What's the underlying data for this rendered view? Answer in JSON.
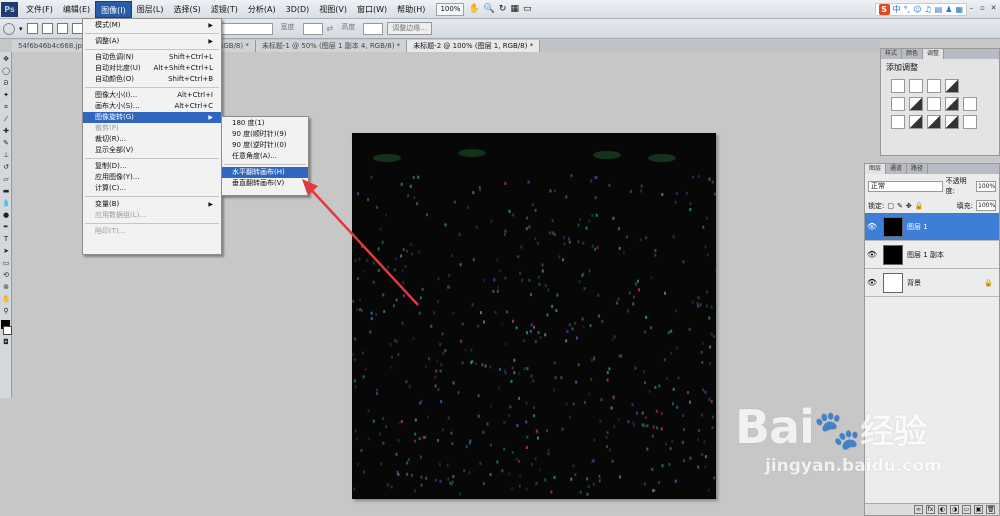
{
  "menubar": {
    "logo": "Ps",
    "items": [
      "文件(F)",
      "编辑(E)",
      "图像(I)",
      "图层(L)",
      "选择(S)",
      "滤镜(T)",
      "分析(A)",
      "3D(D)",
      "视图(V)",
      "窗口(W)",
      "帮助(H)"
    ],
    "active_index": 2,
    "zoom": "100%"
  },
  "optbar": {
    "field1": "宽度",
    "field2": "高度",
    "refine_edge": "调整边缘..."
  },
  "tabs": [
    {
      "label": "54f6b46b4c668.jpg",
      "active": false
    },
    {
      "label": "9824111440.jpg @ 200% (图层 0, RGB/8) *",
      "active": false
    },
    {
      "label": "未标题-1 @ 50% (图层 1 副本 4, RGB/8) *",
      "active": false
    },
    {
      "label": "未标题-2 @ 100% (图层 1, RGB/8) *",
      "active": true
    }
  ],
  "image_menu": {
    "items": [
      {
        "label": "模式(M)",
        "shortcut": "",
        "submenu": true,
        "disabled": false
      },
      {
        "sep": true
      },
      {
        "label": "调整(A)",
        "shortcut": "",
        "submenu": true,
        "disabled": false
      },
      {
        "sep": true
      },
      {
        "label": "自动色调(N)",
        "shortcut": "Shift+Ctrl+L",
        "submenu": false,
        "disabled": false
      },
      {
        "label": "自动对比度(U)",
        "shortcut": "Alt+Shift+Ctrl+L",
        "submenu": false,
        "disabled": false
      },
      {
        "label": "自动颜色(O)",
        "shortcut": "Shift+Ctrl+B",
        "submenu": false,
        "disabled": false
      },
      {
        "sep": true
      },
      {
        "label": "图像大小(I)...",
        "shortcut": "Alt+Ctrl+I",
        "submenu": false,
        "disabled": false
      },
      {
        "label": "画布大小(S)...",
        "shortcut": "Alt+Ctrl+C",
        "submenu": false,
        "disabled": false
      },
      {
        "label": "图像旋转(G)",
        "shortcut": "",
        "submenu": true,
        "disabled": false,
        "selected": true
      },
      {
        "label": "裁剪(P)",
        "shortcut": "",
        "submenu": false,
        "disabled": true
      },
      {
        "label": "裁切(R)...",
        "shortcut": "",
        "submenu": false,
        "disabled": false
      },
      {
        "label": "显示全部(V)",
        "shortcut": "",
        "submenu": false,
        "disabled": false
      },
      {
        "sep": true
      },
      {
        "label": "复制(D)...",
        "shortcut": "",
        "submenu": false,
        "disabled": false
      },
      {
        "label": "应用图像(Y)...",
        "shortcut": "",
        "submenu": false,
        "disabled": false
      },
      {
        "label": "计算(C)...",
        "shortcut": "",
        "submenu": false,
        "disabled": false
      },
      {
        "sep": true
      },
      {
        "label": "变量(B)",
        "shortcut": "",
        "submenu": true,
        "disabled": false
      },
      {
        "label": "应用数据组(L)...",
        "shortcut": "",
        "submenu": false,
        "disabled": true
      },
      {
        "sep": true
      },
      {
        "label": "陷印(T)...",
        "shortcut": "",
        "submenu": false,
        "disabled": true
      }
    ]
  },
  "rotate_submenu": {
    "items": [
      {
        "label": "180 度(1)",
        "selected": false
      },
      {
        "label": "90 度(顺时针)(9)",
        "selected": false
      },
      {
        "label": "90 度(逆时针)(0)",
        "selected": false
      },
      {
        "label": "任意角度(A)...",
        "selected": false
      },
      {
        "sep": true
      },
      {
        "label": "水平翻转画布(H)",
        "selected": true
      },
      {
        "label": "垂直翻转画布(V)",
        "selected": false
      }
    ]
  },
  "adjust_panel": {
    "tabs": [
      "样式",
      "颜色",
      "调整"
    ],
    "title": "添加调整"
  },
  "layers_panel": {
    "tabs": [
      "图层",
      "通道",
      "路径"
    ],
    "blend_mode": "正常",
    "opacity_label": "不透明度:",
    "opacity": "100%",
    "lock_label": "锁定:",
    "fill_label": "填充:",
    "fill": "100%",
    "layers": [
      {
        "name": "图层 1",
        "selected": true,
        "thumb": "#000000",
        "locked": false
      },
      {
        "name": "图层 1 副本",
        "selected": false,
        "thumb": "#000000",
        "locked": false
      },
      {
        "name": "背景",
        "selected": false,
        "thumb": "#ffffff",
        "locked": true
      }
    ]
  },
  "watermark": {
    "brand": "Bai",
    "brand2": "经验",
    "url": "jingyan.baidu.com"
  },
  "colors": {
    "menu_active": "#2a5ba8",
    "selection": "#2f67c0",
    "arrow": "#e03a3a"
  }
}
